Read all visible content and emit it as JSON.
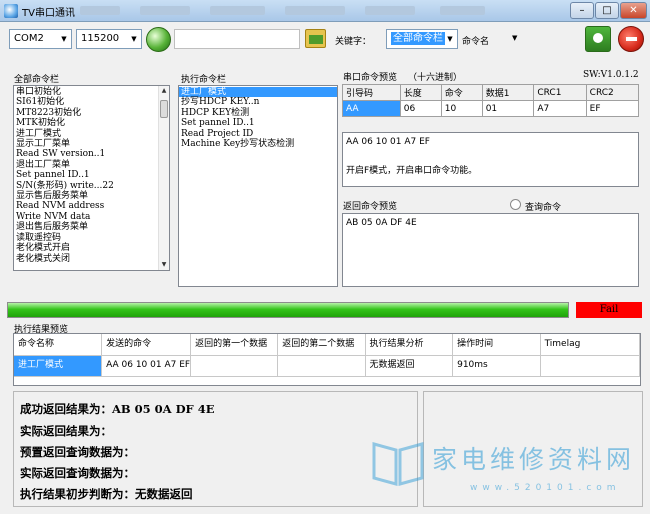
{
  "window": {
    "title": "TV串口通讯"
  },
  "toolbar": {
    "port": "COM2",
    "baud": "115200",
    "keyword_label": "关键字：",
    "keyword_value": "全部命令栏",
    "command_name": "命令名"
  },
  "panels": {
    "all_commands_label": "全部命令栏",
    "exec_commands_label": "执行命令栏",
    "preview_label": "串口命令预览",
    "preview_hex": "（十六进制）",
    "version": "SW:V1.0.1.2",
    "return_preview_label": "返回命令预览",
    "query_label": "查询命令",
    "exec_result_label": "执行结果预览"
  },
  "all_commands": [
    "串口初始化",
    "SI61初始化",
    "MT8223初始化",
    "MTK初始化",
    "进工厂模式",
    "显示工厂菜单",
    "Read SW version..1",
    "退出工厂菜单",
    "Set pannel ID..1",
    "S/N(条形码) write...22",
    "显示售后服务菜单",
    "Read NVM address",
    "Write NVM data",
    "退出售后服务菜单",
    "读取遥控码",
    "老化模式开启",
    "老化模式关闭"
  ],
  "exec_commands": [
    "进工厂模式",
    "抄写HDCP KEY..n",
    "HDCP KEY检测",
    "Set pannel ID..1",
    "Read Project ID",
    "Machine Key抄写状态检测"
  ],
  "cmd_table": {
    "headers": [
      "引导码",
      "长度",
      "命令",
      "数据1",
      "CRC1",
      "CRC2"
    ],
    "row": [
      "AA",
      "06",
      "10",
      "01",
      "A7",
      "EF"
    ]
  },
  "preview_text": {
    "hex": "AA 06 10 01 A7 EF",
    "desc": "开启F模式，开启串口命令功能。"
  },
  "return_text": "AB 05 0A DF 4E",
  "progress": {
    "percent": 100,
    "status": "Fail"
  },
  "result_table": {
    "headers": [
      "命令名称",
      "发送的命令",
      "返回的第一个数据",
      "返回的第二个数据",
      "执行结果分析",
      "操作时间",
      "Timelag"
    ],
    "row": [
      "进工厂模式",
      "AA 06 10 01 A7 EF",
      "",
      "",
      "无数据返回",
      "910ms",
      ""
    ]
  },
  "summary": {
    "line1": "成功返回结果为：AB 05 0A DF 4E",
    "line2": "实际返回结果为：",
    "line3": "预置返回查询数据为：",
    "line4": "实际返回查询数据为：",
    "line5": "执行结果初步判断为：无数据返回"
  },
  "watermark": {
    "text": "家电维修资料网",
    "url": "www.520101.com"
  },
  "colors": {
    "selection": "#3399ff",
    "fail": "#ff0000",
    "progress": "#34c41a"
  }
}
